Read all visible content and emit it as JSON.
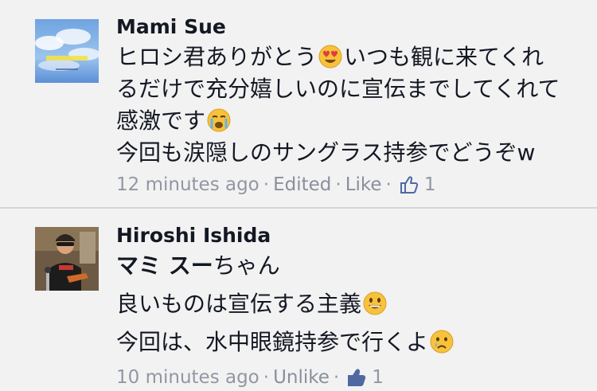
{
  "comments": [
    {
      "author": "Mami Sue",
      "avatar_icon": "album-cover-sky-icon",
      "lines": [
        {
          "before": "ヒロシ君ありがとう",
          "emoji": "heart-eyes-emoji-icon",
          "after": "いつも観に来てくれ"
        },
        {
          "text": "るだけで充分嬉しいのに宣伝までしてくれて"
        },
        {
          "before": "感激です",
          "emoji": "crying-emoji-icon",
          "after": ""
        },
        {
          "text": "今回も涙隠しのサングラス持参でどうぞw"
        }
      ],
      "time": "12 minutes ago",
      "actions": [
        "Edited",
        "Like"
      ],
      "like_count": "1"
    },
    {
      "author": "Hiroshi Ishida",
      "avatar_icon": "guitarist-photo-icon",
      "mention": "マミ スー",
      "mention_suffix": "ちゃん",
      "lines": [
        {
          "before": "良いものは宣伝する主義",
          "emoji": "grin-emoji-icon",
          "after": ""
        },
        {
          "before": "今回は、水中眼鏡持参で行くよ",
          "emoji": "sad-tear-emoji-icon",
          "after": ""
        }
      ],
      "time": "10 minutes ago",
      "actions": [
        "Unlike"
      ],
      "like_count": "1"
    }
  ],
  "colors": {
    "background": "#f2f2f2",
    "text": "#141823",
    "meta": "#9197a3",
    "like_blue": "#4e69a2",
    "divider": "#d5d5d8"
  }
}
